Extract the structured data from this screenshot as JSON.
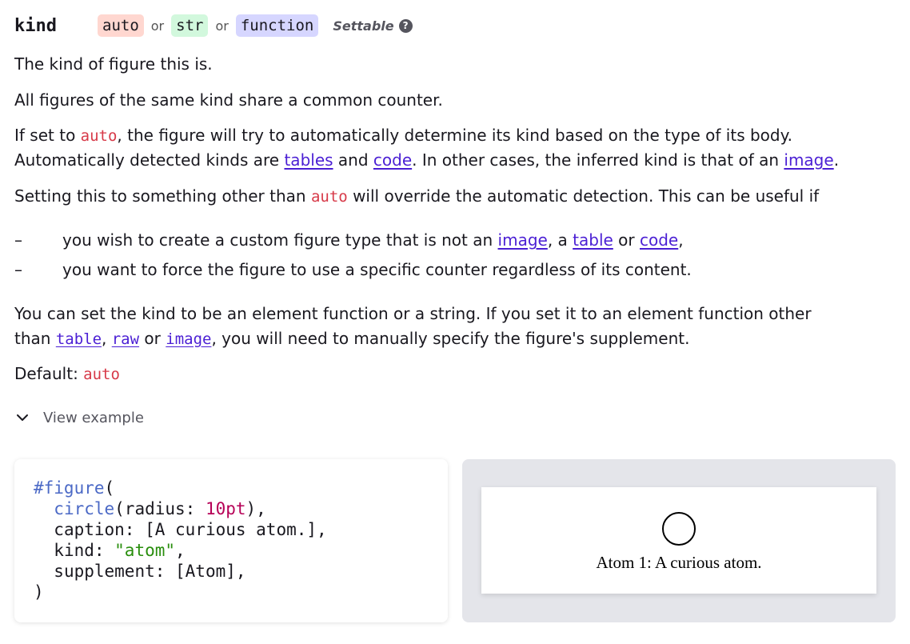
{
  "param": {
    "name": "kind",
    "types": [
      "auto",
      "str",
      "function"
    ],
    "or_word": "or",
    "settable_label": "Settable",
    "help_icon": "?"
  },
  "description": {
    "p1": "The kind of figure this is.",
    "p2": "All figures of the same kind share a common counter.",
    "p3": {
      "a": "If set to ",
      "code1": "auto",
      "b": ", the figure will try to automatically determine its kind based on the type of its body.",
      "c": "Automatically detected kinds are ",
      "link_tables": "tables",
      "d": " and ",
      "link_code": "code",
      "e": ". In other cases, the inferred kind is that of an ",
      "link_image": "image",
      "f": "."
    },
    "p4": {
      "a": "Setting this to something other than ",
      "code1": "auto",
      "b": " will override the automatic detection. This can be useful if"
    },
    "bullet_marker": "–",
    "bullet1": {
      "a": "you wish to create a custom figure type that is not an ",
      "link_image": "image",
      "b": ", a ",
      "link_table": "table",
      "c": " or ",
      "link_code": "code",
      "d": ","
    },
    "bullet2": "you want to force the figure to use a specific counter regardless of its content.",
    "p5": {
      "a": "You can set the kind to be an element function or a string. If you set it to an element function other",
      "b": "than ",
      "link_table": "table",
      "c": ", ",
      "link_raw": "raw",
      "d": " or ",
      "link_image": "image",
      "e": ", you will need to manually specify the figure's supplement."
    },
    "default_label": "Default: ",
    "default_value": "auto"
  },
  "example": {
    "toggle_label": "View example",
    "toggle_icon": "chevron-down-icon",
    "code": {
      "l1_fn": "#figure",
      "l1_rest": "(",
      "l2_fn": "circle",
      "l2_a": "(radius: ",
      "l2_num": "10pt",
      "l2_b": "),",
      "l3": "caption: [A curious atom.],",
      "l4_a": "kind: ",
      "l4_str": "\"atom\"",
      "l4_b": ",",
      "l5": "supplement: [Atom],",
      "l6": ")"
    },
    "preview_caption": "Atom 1: A curious atom."
  },
  "colors": {
    "link": "#4b1fd4",
    "inline_code": "#d73948",
    "pill_auto": "#ffd7d0",
    "pill_str": "#d2f8dd",
    "pill_function": "#d6d6ff",
    "code_function": "#4b69c6",
    "code_number": "#b60157",
    "code_string": "#298e0d",
    "preview_background": "#e4e5ea"
  }
}
